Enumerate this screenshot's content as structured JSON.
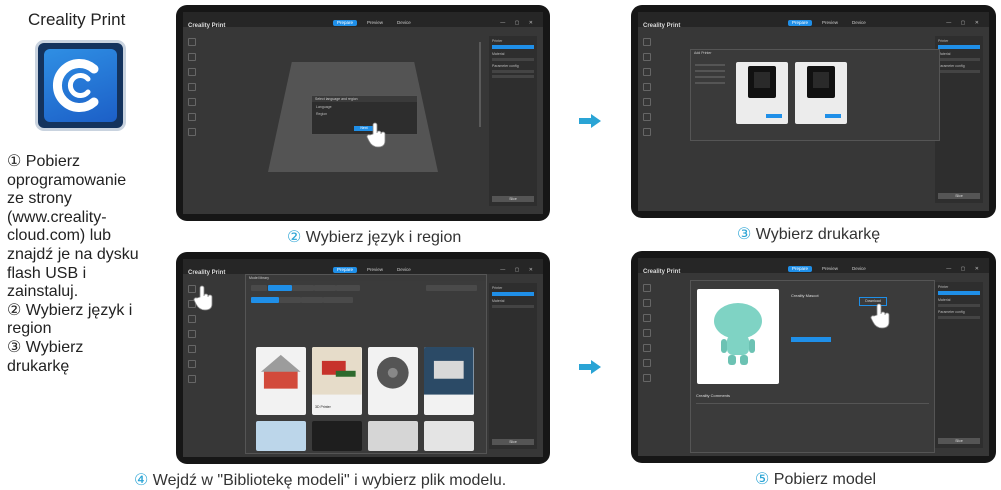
{
  "app_name": "Creality Print",
  "instructions_lines": [
    "① Pobierz",
    "oprogramowanie",
    "ze strony",
    "(www.creality-",
    "cloud.com) lub",
    "znajdź je na dysku",
    "flash USB i",
    "zainstaluj.",
    "② Wybierz język i",
    "region",
    "③ Wybierz",
    "drukarkę"
  ],
  "steps": [
    {
      "num": "②",
      "caption": "Wybierz język i region"
    },
    {
      "num": "③",
      "caption": "Wybierz drukarkę"
    },
    {
      "num": "④",
      "caption_pre": "Wejdź w \"",
      "caption_link": "Bibliotekę modeli",
      "caption_post": "\" i wybierz plik modelu."
    },
    {
      "num": "⑤",
      "caption": "Pobierz model"
    }
  ],
  "software": {
    "app_title": "Creality Print",
    "tabs": [
      "Prepare",
      "Preview",
      "Device"
    ],
    "active_tab": "Prepare",
    "right_panel": {
      "printer_header": "Printer",
      "material_header": "Material",
      "param_header": "Parameter config",
      "slice_button": "Slice"
    },
    "dialog_language": {
      "title": "Select language and region",
      "fields": [
        "Language",
        "Region"
      ],
      "button": "Next"
    },
    "dialog_printer": {
      "title": "Add Printer"
    },
    "library": {
      "title": "Model library",
      "models": [
        "",
        "3D Printer",
        "",
        ""
      ]
    },
    "download": {
      "model_name": "Creality Mascot",
      "button": "Download",
      "comments_label": "Creality Comments"
    }
  },
  "colors": {
    "accent": "#1f8fe8",
    "arrow": "#2aa4d5",
    "screen_bg": "#373737"
  }
}
